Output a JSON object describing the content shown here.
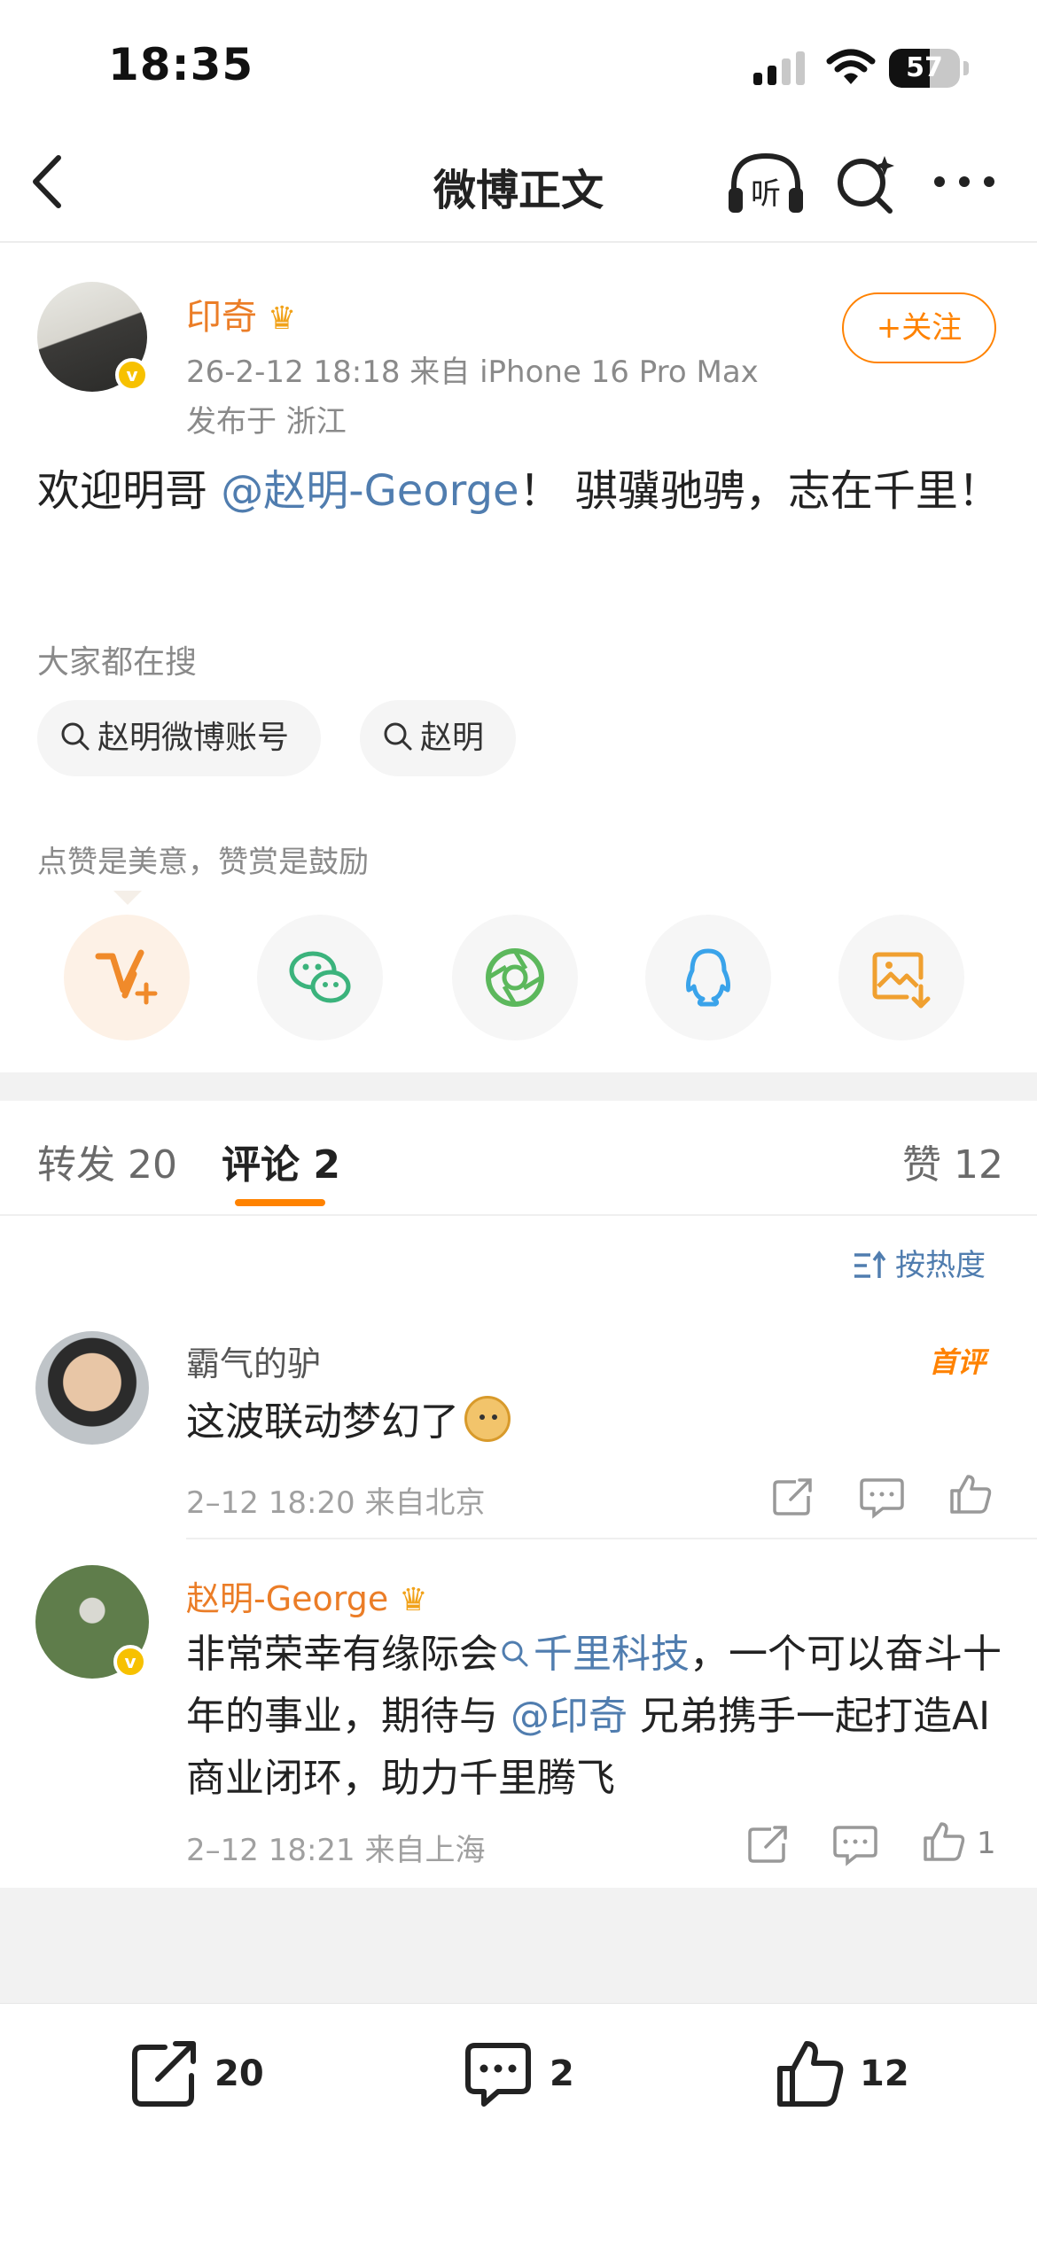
{
  "status_bar": {
    "time": "18:35",
    "battery": "57",
    "battery_level": 0.57
  },
  "nav": {
    "title": "微博正文",
    "listen_label": "听"
  },
  "post": {
    "author": "印奇",
    "time_source": "26-2-12 18:18  来自 iPhone 16 Pro Max",
    "location": "发布于 浙江",
    "follow_label": "+关注",
    "body_prefix": "欢迎明哥 ",
    "mention": "@赵明-George",
    "body_suffix": "！ 骐骥驰骋，志在千里！"
  },
  "search": {
    "label": "大家都在搜",
    "chips": [
      "赵明微博账号",
      "赵明"
    ]
  },
  "reward_hint": "点赞是美意，赞赏是鼓励",
  "share_icons": [
    "reward-icon",
    "wechat-icon",
    "moments-icon",
    "qq-icon",
    "save-image-icon"
  ],
  "tabs": {
    "repost": "转发 20",
    "comment": "评论 2",
    "like": "赞 12"
  },
  "sort_label": "按热度",
  "comments": [
    {
      "name": "霸气的驴",
      "tag": "首评",
      "text": "这波联动梦幻了",
      "meta": "2–12 18:20  来自北京",
      "likes": ""
    },
    {
      "name": "赵明-George",
      "text_prefix": "非常荣幸有缘际会",
      "topic": "千里科技",
      "text_mid": "，一个可以奋斗十年的事业，期待与 ",
      "mention": "@印奇",
      "text_suffix": " 兄弟携手一起打造AI商业闭环，助力千里腾飞",
      "meta": "2–12 18:21  来自上海",
      "likes": "1"
    }
  ],
  "bottom_bar": {
    "repost": "20",
    "comment": "2",
    "like": "12"
  },
  "colors": {
    "accent": "#ff8200",
    "name_orange": "#eb7d27",
    "link_blue": "#507daf",
    "verify_gold": "#f7c100"
  }
}
